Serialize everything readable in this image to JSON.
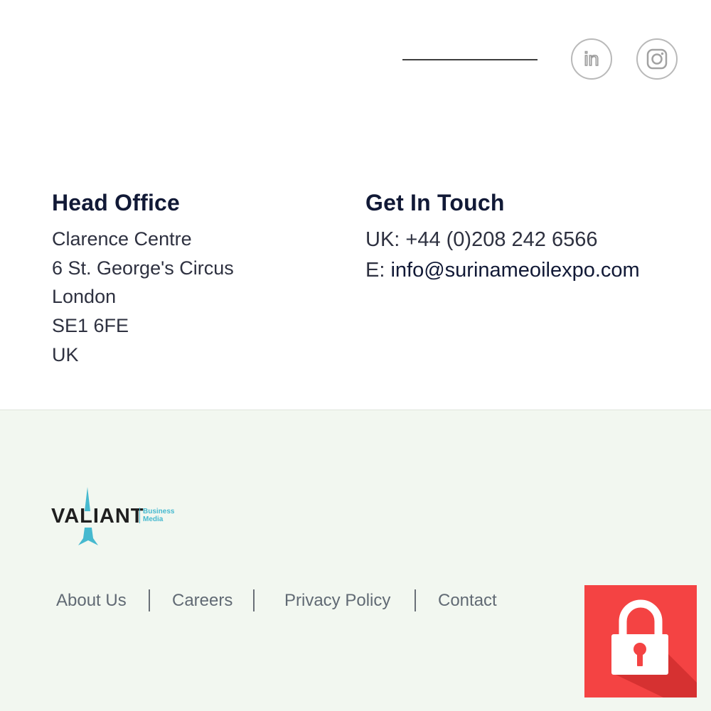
{
  "header": {
    "social_links": [
      {
        "label": "in",
        "icon": "linkedin-icon"
      },
      {
        "icon": "instagram-icon"
      }
    ]
  },
  "head_office": {
    "title": "Head Office",
    "lines": [
      "Clarence Centre",
      "6 St. George's Circus",
      "London",
      "SE1 6FE",
      "UK"
    ]
  },
  "get_in_touch": {
    "title": "Get In Touch",
    "phone": "UK: +44 (0)208 242 6566",
    "email_prefix": "E: ",
    "email": "info@surinameoilexpo.com"
  },
  "footer": {
    "logo": {
      "name": "VALIANT",
      "sub_line_1": "Business",
      "sub_line_2": "Media"
    },
    "links": [
      {
        "label": "About Us"
      },
      {
        "label": "Careers"
      },
      {
        "label": "Privacy Policy"
      },
      {
        "label": "Contact"
      }
    ]
  },
  "colors": {
    "title": "#111936",
    "body_text": "#2e3140",
    "footer_bg": "#f2f7f0",
    "footer_link": "#616a74",
    "logo_accent": "#46b9cf",
    "lock_badge": "#f44343"
  }
}
